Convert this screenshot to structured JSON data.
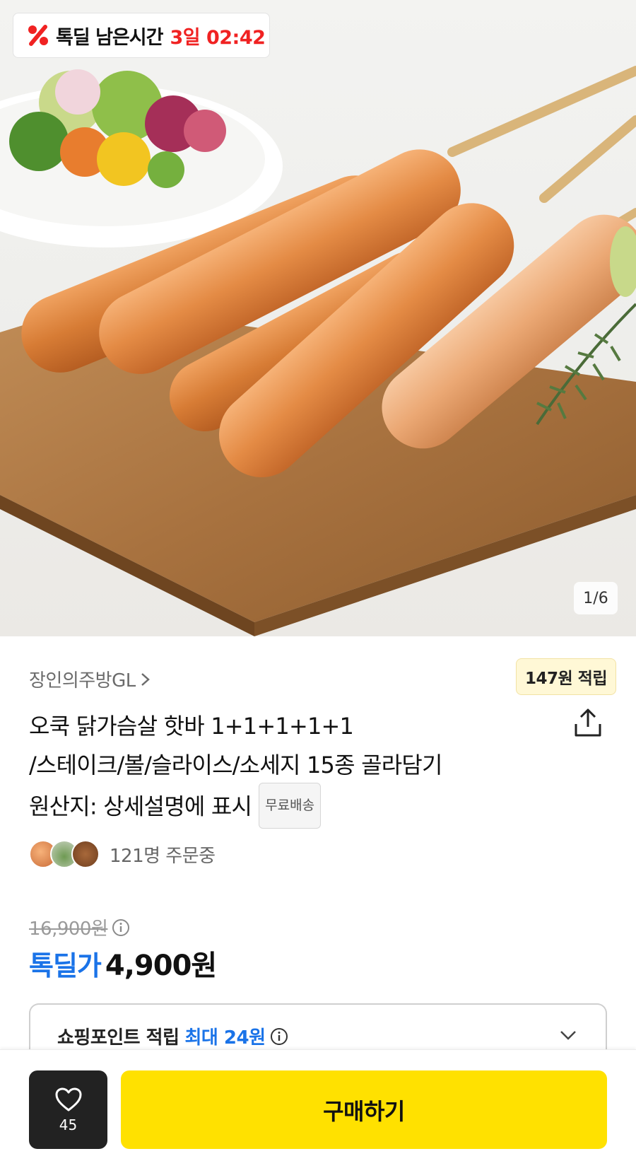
{
  "deal_timer": {
    "label": "톡딜 남은시간",
    "remaining": "3일 02:42",
    "accent_color": "#f02222"
  },
  "gallery": {
    "counter": "1/6"
  },
  "product": {
    "seller": "장인의주방GL",
    "points_badge": "147원 적립",
    "title_lines": [
      "오쿡 닭가슴살 핫바 1+1+1+1+1",
      "/스테이크/볼/슬라이스/소세지 15종 골라담기",
      "원산지: 상세설명에 표시"
    ],
    "free_shipping_badge": "무료배송",
    "buyers_text": "121명 주문중",
    "original_price": "16,900원",
    "deal_price_label": "톡딜가",
    "deal_price": "4,900원",
    "deal_color": "#1a73e8"
  },
  "shopping_points": {
    "label": "쇼핑포인트 적립",
    "value": "최대 24원"
  },
  "bottom_bar": {
    "wishlist_count": "45",
    "buy_label": "구매하기",
    "buy_color": "#ffe100"
  }
}
